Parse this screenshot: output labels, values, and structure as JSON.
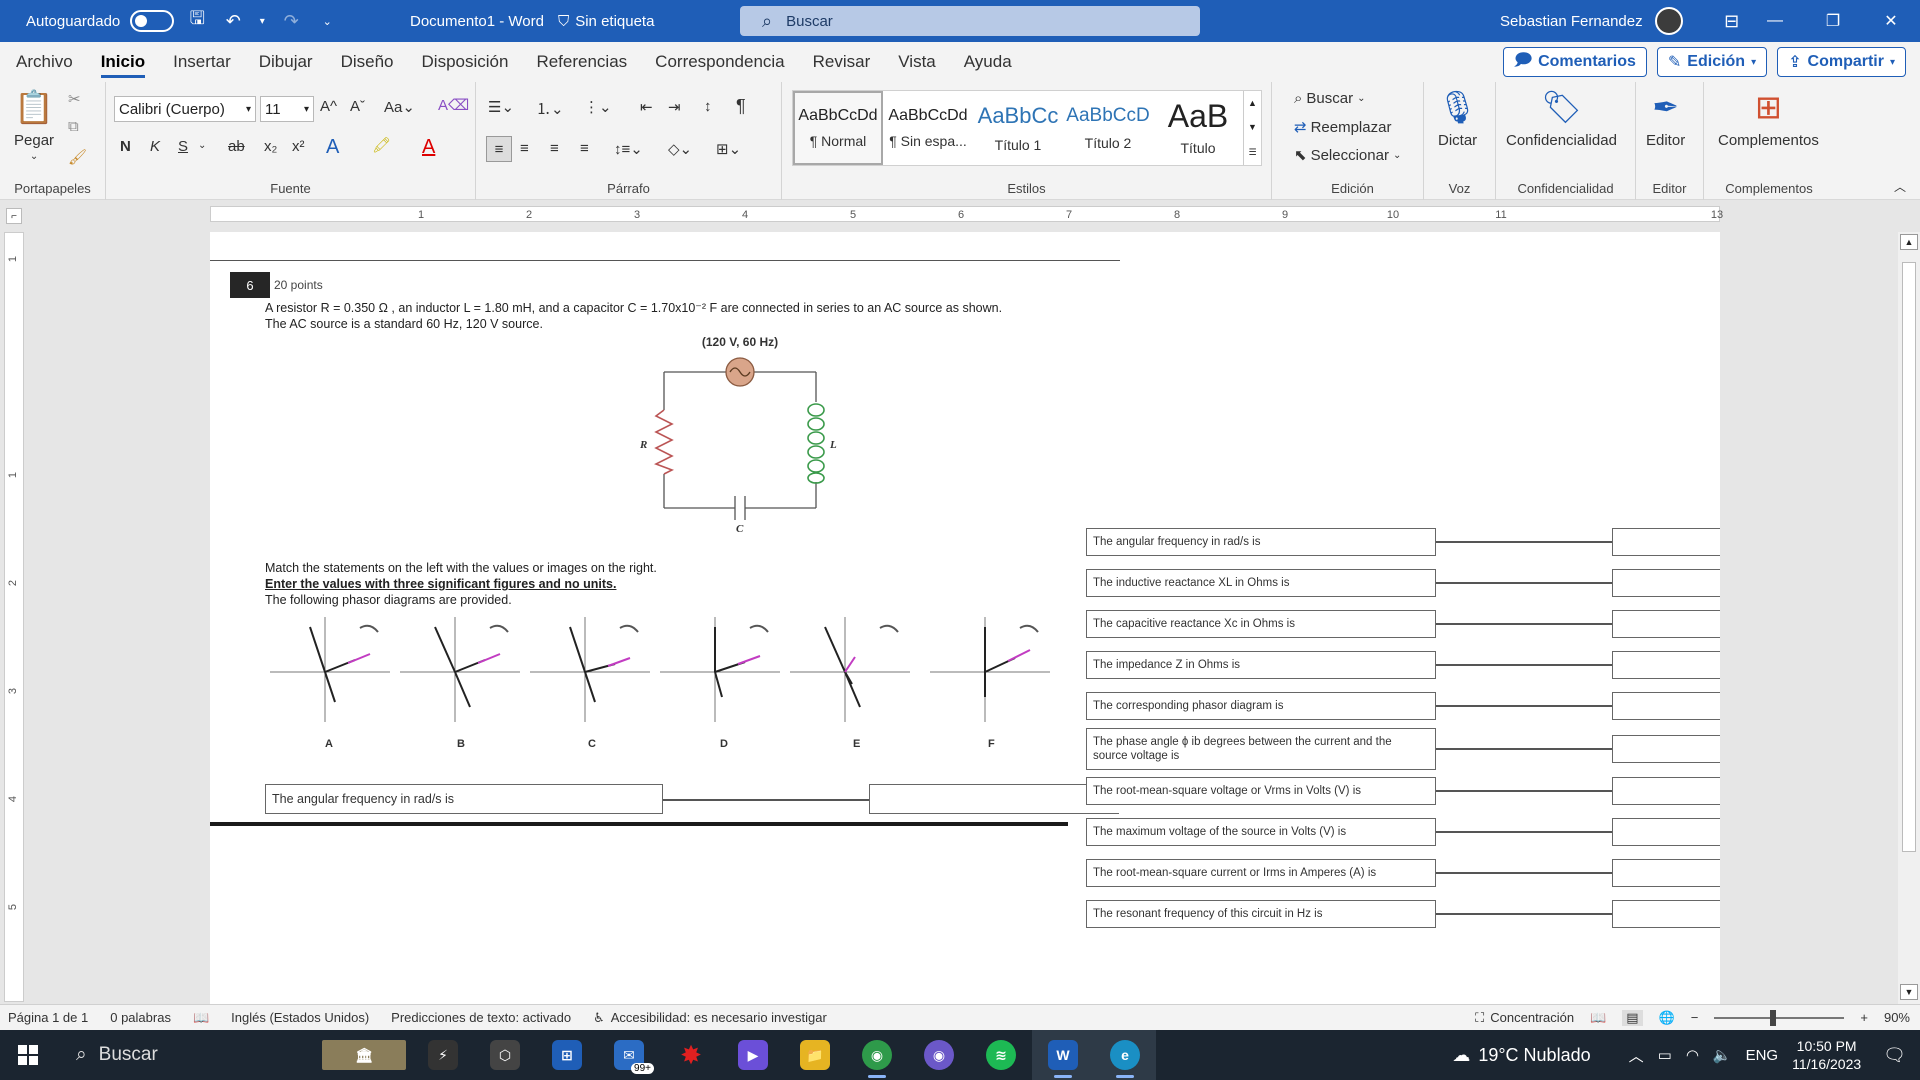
{
  "titlebar": {
    "autosave_label": "Autoguardado",
    "doc_title": "Documento1  -  Word",
    "label_tag": "Sin etiqueta",
    "search_placeholder": "Buscar",
    "user_name": "Sebastian Fernandez"
  },
  "menu": {
    "tabs": [
      "Archivo",
      "Inicio",
      "Insertar",
      "Dibujar",
      "Diseño",
      "Disposición",
      "Referencias",
      "Correspondencia",
      "Revisar",
      "Vista",
      "Ayuda"
    ],
    "active_tab": "Inicio",
    "comments_label": "Comentarios",
    "edit_label": "Edición",
    "share_label": "Compartir"
  },
  "ribbon": {
    "paste_label": "Pegar",
    "groups": {
      "clipboard": "Portapapeles",
      "font": "Fuente",
      "paragraph": "Párrafo",
      "styles": "Estilos",
      "editing": "Edición",
      "voice": "Voz",
      "sensitivity": "Confidencialidad",
      "editor": "Editor",
      "addins": "Complementos"
    },
    "font_name": "Calibri (Cuerpo)",
    "font_size": "11",
    "styles": [
      {
        "preview": "AaBbCcDd",
        "name": "¶ Normal"
      },
      {
        "preview": "AaBbCcDd",
        "name": "¶ Sin espa..."
      },
      {
        "preview": "AaBbCc",
        "name": "Título 1"
      },
      {
        "preview": "AaBbCcD",
        "name": "Título 2"
      },
      {
        "preview": "AaB",
        "name": "Título"
      }
    ],
    "find_label": "Buscar",
    "replace_label": "Reemplazar",
    "select_label": "Seleccionar",
    "dictate_label": "Dictar",
    "sensitivity_label": "Confidencialidad",
    "editor_label": "Editor",
    "addins_label": "Complementos"
  },
  "ruler": {
    "marks": [
      "1",
      "2",
      "3",
      "4",
      "5",
      "6",
      "7",
      "8",
      "9",
      "10",
      "11",
      "13"
    ],
    "vmarks": [
      "1",
      "1",
      "2",
      "3",
      "4",
      "5"
    ]
  },
  "question": {
    "number": "6",
    "points": "20 points",
    "line1": "A resistor R = 0.350 Ω , an inductor L = 1.80 mH, and a capacitor C = 1.70x10⁻² F are connected in series to an AC source as shown.",
    "line2": "The AC source is a standard 60 Hz, 120 V source.",
    "source_label": "(120 V, 60 Hz)",
    "r_label": "R",
    "l_label": "L",
    "c_label": "C",
    "inst1": "Match the statements on the left with the values or images on the right.",
    "inst2": "Enter the values with three significant figures and no units.",
    "inst3": "The following phasor diagrams are provided.",
    "phasor_letters": [
      "A",
      "B",
      "C",
      "D",
      "E",
      "F"
    ],
    "left_prompt": "The angular frequency in rad/s is",
    "matches": [
      "The angular frequency in rad/s is",
      "The inductive reactance XL in Ohms is",
      "The capacitive reactance Xc in Ohms is",
      "The impedance Z in Ohms is",
      "The corresponding phasor diagram is",
      "The phase angle ϕ ib degrees between the current and the source voltage is",
      "The root-mean-square voltage or Vrms in Volts (V) is",
      "The maximum voltage of the source in Volts (V) is",
      "The root-mean-square current or Irms in Amperes (A) is",
      "The resonant frequency of this circuit in Hz is"
    ]
  },
  "statusbar": {
    "page": "Página 1 de 1",
    "words": "0 palabras",
    "language": "Inglés (Estados Unidos)",
    "predictions": "Predicciones de texto: activado",
    "accessibility": "Accesibilidad: es necesario investigar",
    "focus": "Concentración",
    "zoom": "90%"
  },
  "taskbar": {
    "search_label": "Buscar",
    "badge": "99+",
    "weather": "19°C  Nublado",
    "lang": "ENG",
    "time": "10:50 PM",
    "date": "11/16/2023"
  },
  "colors": {
    "accent": "#1f5eb7",
    "resistor": "#b55",
    "inductor": "#3a9a4a",
    "source": "#d9a58a",
    "current_vector": "#c23cc2"
  }
}
